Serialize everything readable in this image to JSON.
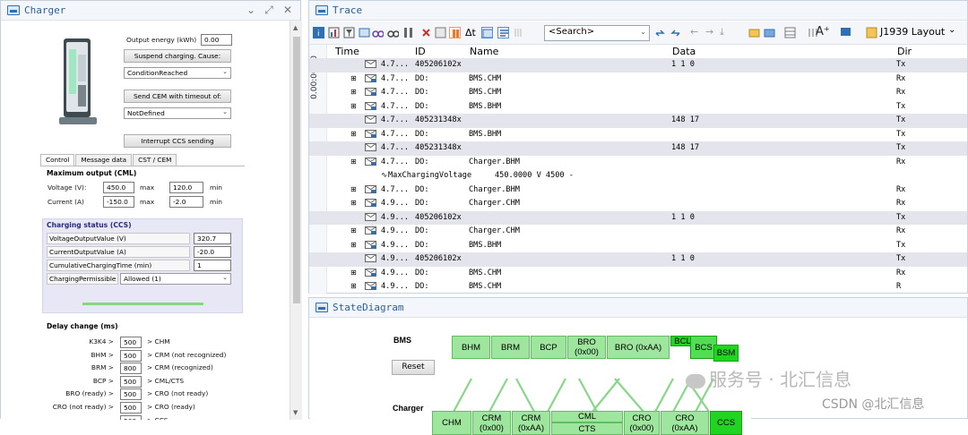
{
  "charger": {
    "title": "Charger",
    "output_energy_label": "Output energy (kWh)",
    "output_energy_value": "0.00",
    "suspend_button": "Suspend charging. Cause:",
    "cause_select": "ConditionReached",
    "send_cem_button": "Send CEM with timeout of:",
    "timeout_select": "NotDefined",
    "interrupt_button": "Interrupt CCS sending",
    "tabs": [
      "Control",
      "Message data",
      "CST / CEM"
    ],
    "max_output": {
      "heading": "Maximum output (CML)",
      "voltage_label": "Voltage (V):",
      "voltage_value": "450.0",
      "voltage_max_label": "max",
      "voltage_max_value": "120.0",
      "voltage_min_label": "min",
      "current_label": "Current (A)",
      "current_value": "-150.0",
      "current_max_label": "max",
      "current_max_value": "-2.0",
      "current_min_label": "min"
    },
    "status": {
      "heading": "Charging status (CCS)",
      "rows": [
        {
          "label": "VoltageOutputValue (V)",
          "value": "320.7"
        },
        {
          "label": "CurrentOutputValue (A)",
          "value": "-20.0"
        },
        {
          "label": "CumulativeChargingTime (min)",
          "value": "1"
        },
        {
          "label": "ChargingPermissible",
          "value": "Allowed (1)"
        }
      ]
    },
    "delay": {
      "heading": "Delay change (ms)",
      "rows": [
        {
          "label": "K3K4 >",
          "value": "500",
          "target": "> CHM"
        },
        {
          "label": "BHM >",
          "value": "500",
          "target": "> CRM (not recognized)"
        },
        {
          "label": "BRM >",
          "value": "800",
          "target": "> CRM (recognized)"
        },
        {
          "label": "BCP >",
          "value": "500",
          "target": "> CML/CTS"
        },
        {
          "label": "BRO (ready) >",
          "value": "500",
          "target": "> CRO (not ready)"
        },
        {
          "label": "CRO (not ready) >",
          "value": "500",
          "target": "> CRO (ready)"
        },
        {
          "label": "",
          "value": "500",
          "target": "> CCS"
        }
      ]
    }
  },
  "trace": {
    "title": "Trace",
    "search_placeholder": "<Search>",
    "layout_label": "J1939 Layout",
    "columns": {
      "time": "Time",
      "id": "ID",
      "name": "Name",
      "data": "Data",
      "dir": "Dir"
    },
    "time_axis": "0.00:00.00",
    "rows": [
      {
        "time": "4.7...",
        "id": "405206102x",
        "name": "",
        "data": "1  1  0",
        "dir": "Tx",
        "kind": "raw"
      },
      {
        "time": "4.7...",
        "id": "DO:",
        "name": "BMS.CHM",
        "data": "",
        "dir": "Rx",
        "kind": "msg"
      },
      {
        "time": "4.7...",
        "id": "DO:",
        "name": "BMS.CHM",
        "data": "",
        "dir": "Rx",
        "kind": "msg"
      },
      {
        "time": "4.7...",
        "id": "DO:",
        "name": "BMS.BHM",
        "data": "",
        "dir": "Tx",
        "kind": "msg"
      },
      {
        "time": "4.7...",
        "id": "405231348x",
        "name": "",
        "data": "148  17",
        "dir": "Tx",
        "kind": "raw"
      },
      {
        "time": "4.7...",
        "id": "DO:",
        "name": "BMS.BHM",
        "data": "",
        "dir": "Tx",
        "kind": "msg"
      },
      {
        "time": "4.7...",
        "id": "405231348x",
        "name": "",
        "data": "148  17",
        "dir": "Tx",
        "kind": "raw"
      },
      {
        "time": "4.7...",
        "id": "DO:",
        "name": "Charger.BHM",
        "data": "",
        "dir": "Rx",
        "kind": "msg"
      },
      {
        "time": "",
        "id": "",
        "name": "MaxChargingVoltage",
        "data": "450.0000 V        4500    -",
        "dir": "",
        "kind": "signal"
      },
      {
        "time": "4.7...",
        "id": "DO:",
        "name": "Charger.BHM",
        "data": "",
        "dir": "Rx",
        "kind": "msg"
      },
      {
        "time": "4.9...",
        "id": "DO:",
        "name": "Charger.CHM",
        "data": "",
        "dir": "Rx",
        "kind": "msg"
      },
      {
        "time": "4.9...",
        "id": "405206102x",
        "name": "",
        "data": "1  1  0",
        "dir": "Tx",
        "kind": "raw"
      },
      {
        "time": "4.9...",
        "id": "DO:",
        "name": "Charger.CHM",
        "data": "",
        "dir": "Rx",
        "kind": "msg"
      },
      {
        "time": "4.9...",
        "id": "DO:",
        "name": "BMS.BHM",
        "data": "",
        "dir": "Tx",
        "kind": "msg"
      },
      {
        "time": "4.9...",
        "id": "405206102x",
        "name": "",
        "data": "1  1  0",
        "dir": "Tx",
        "kind": "raw"
      },
      {
        "time": "4.9...",
        "id": "DO:",
        "name": "BMS.CHM",
        "data": "",
        "dir": "Rx",
        "kind": "msg"
      },
      {
        "time": "4.9...",
        "id": "DO:",
        "name": "BMS.CHM",
        "data": "",
        "dir": "R",
        "kind": "msg"
      }
    ]
  },
  "state": {
    "title": "StateDiagram",
    "bms_label": "BMS",
    "charger_label": "Charger",
    "reset_button": "Reset",
    "bms_states": [
      "BHM",
      "BRM",
      "BCP",
      "BRO\n(0x00)",
      "BRO (0xAA)",
      "BCL",
      "BCS",
      "BSM"
    ],
    "charger_states": [
      "CHM",
      "CRM\n(0x00)",
      "CRM\n(0xAA)",
      "CML",
      "CTS",
      "CRO\n(0x00)",
      "CRO (0xAA)",
      "CCS"
    ],
    "active_color": "#22d422",
    "inactive_color": "#9ee59e"
  },
  "watermark": {
    "main": "服务号 · 北汇信息",
    "sub": "CSDN @北汇信息"
  }
}
